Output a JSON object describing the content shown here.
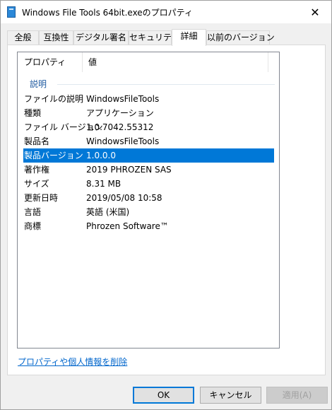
{
  "window": {
    "title": "Windows File Tools 64bit.exeのプロパティ",
    "close_glyph": "✕"
  },
  "tabs": [
    {
      "label": "全般"
    },
    {
      "label": "互換性"
    },
    {
      "label": "デジタル署名"
    },
    {
      "label": "セキュリティ"
    },
    {
      "label": "詳細",
      "active": true
    },
    {
      "label": "以前のバージョン"
    }
  ],
  "listview": {
    "columns": [
      "プロパティ",
      "値"
    ],
    "group": "説明",
    "rows": [
      {
        "key": "ファイルの説明",
        "value": "WindowsFileTools"
      },
      {
        "key": "種類",
        "value": "アプリケーション"
      },
      {
        "key": "ファイル バージョン",
        "value": "1.0.7042.55312"
      },
      {
        "key": "製品名",
        "value": "WindowsFileTools"
      },
      {
        "key": "製品バージョン",
        "value": "1.0.0.0",
        "selected": true
      },
      {
        "key": "著作権",
        "value": "2019 PHROZEN SAS"
      },
      {
        "key": "サイズ",
        "value": "8.31 MB"
      },
      {
        "key": "更新日時",
        "value": "2019/05/08 10:58"
      },
      {
        "key": "言語",
        "value": "英語 (米国)"
      },
      {
        "key": "商標",
        "value": "Phrozen Software™"
      }
    ]
  },
  "link": {
    "remove": "プロパティや個人情報を削除"
  },
  "buttons": {
    "ok": "OK",
    "cancel": "キャンセル",
    "apply": "適用(A)"
  },
  "colors": {
    "selection": "#0078d7",
    "link": "#0066cc",
    "group_header": "#1e5aa0"
  }
}
